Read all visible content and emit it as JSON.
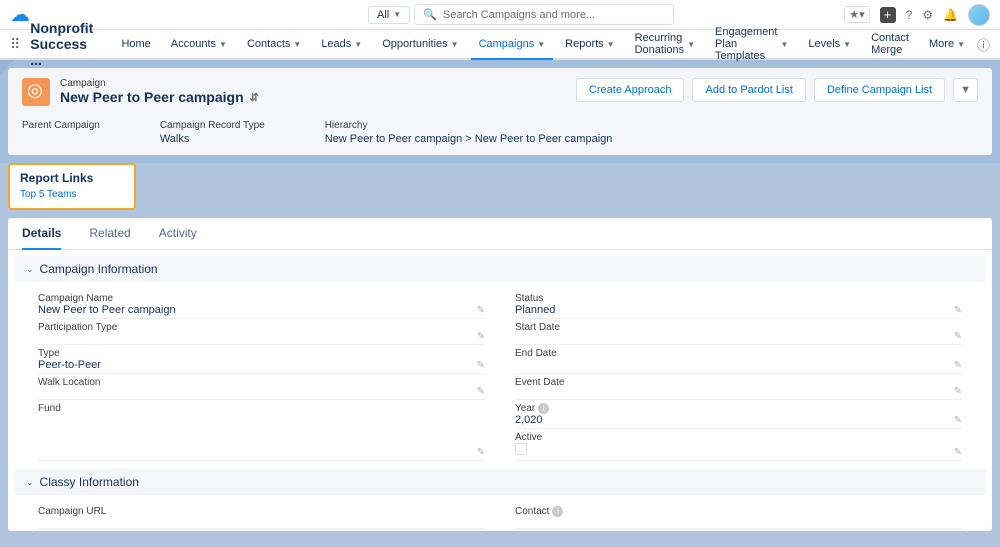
{
  "search": {
    "scope": "All",
    "placeholder": "Search Campaigns and more..."
  },
  "app": {
    "name": "Nonprofit Success ..."
  },
  "nav": {
    "items": [
      "Home",
      "Accounts",
      "Contacts",
      "Leads",
      "Opportunities",
      "Campaigns",
      "Reports",
      "Recurring Donations",
      "Engagement Plan Templates",
      "Levels",
      "Contact Merge",
      "More"
    ],
    "active": "Campaigns"
  },
  "header": {
    "object_label": "Campaign",
    "record_name": "New Peer to Peer campaign",
    "actions": {
      "create": "Create Approach",
      "pardot": "Add to Pardot List",
      "define": "Define Campaign List"
    },
    "fields": {
      "parent": {
        "label": "Parent Campaign",
        "value": ""
      },
      "record_type": {
        "label": "Campaign Record Type",
        "value": "Walks"
      },
      "hierarchy": {
        "label": "Hierarchy",
        "value": "New Peer to Peer campaign > New Peer to Peer campaign"
      }
    }
  },
  "report_links": {
    "title": "Report Links",
    "link1": "Top 5 Teams"
  },
  "tabs": {
    "details": "Details",
    "related": "Related",
    "activity": "Activity",
    "active": "Details"
  },
  "sections": {
    "campaign_info": {
      "title": "Campaign Information",
      "left": [
        {
          "label": "Campaign Name",
          "value": "New Peer to Peer campaign"
        },
        {
          "label": "Participation Type",
          "value": ""
        },
        {
          "label": "Type",
          "value": "Peer-to-Peer"
        },
        {
          "label": "Walk Location",
          "value": ""
        },
        {
          "label": "Fund",
          "value": ""
        }
      ],
      "right": [
        {
          "label": "Status",
          "value": "Planned"
        },
        {
          "label": "Start Date",
          "value": ""
        },
        {
          "label": "End Date",
          "value": ""
        },
        {
          "label": "Event Date",
          "value": ""
        },
        {
          "label": "Year",
          "value": "2,020",
          "help": true
        },
        {
          "label": "Active",
          "checkbox": true
        }
      ]
    },
    "classy_info": {
      "title": "Classy Information",
      "left": [
        {
          "label": "Campaign URL",
          "value": ""
        }
      ],
      "right": [
        {
          "label": "Contact",
          "value": "",
          "help": true
        }
      ]
    }
  }
}
